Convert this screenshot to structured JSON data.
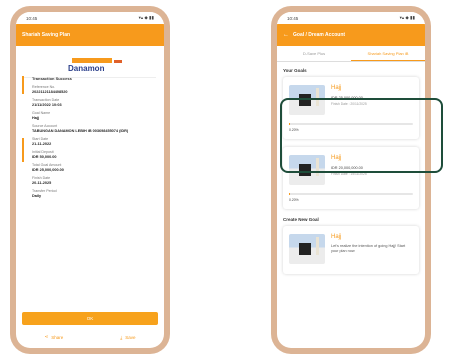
{
  "left": {
    "status_time": "10:45",
    "status_icons": "▾▴ ◆ ▮▮",
    "title": "Shariah Saving Plan",
    "bank_logo": "Danamon",
    "transaction_title": "Transaction Success",
    "fields": [
      {
        "label": "Reference No.",
        "value": "20221121184408520"
      },
      {
        "label": "Transaction Date",
        "value": "21/11/2022 10:03"
      },
      {
        "label": "Goal Name",
        "value": "Hajj"
      },
      {
        "label": "Source Account",
        "value": "TABUNGAN DANAMON LEBIH iB 003698455074 (IDR)"
      },
      {
        "label": "Start Date",
        "value": "21-11-2022"
      },
      {
        "label": "Initial Deposit",
        "value": "IDR 50,000.00"
      },
      {
        "label": "Total Goal Amount",
        "value": "IDR 25,000,000.00"
      },
      {
        "label": "Finish Date",
        "value": "20-11-2025"
      },
      {
        "label": "Transfer Period",
        "value": "Daily"
      }
    ],
    "ok_label": "OK",
    "share_label": "Share",
    "save_label": "Save"
  },
  "right": {
    "status_time": "10:45",
    "status_icons": "▾▴ ◆ ▮▮",
    "title": "Goal / Dream Account",
    "tabs": [
      {
        "label": "D-Save Plus"
      },
      {
        "label": "Shariah Saving Plan iB"
      }
    ],
    "your_goals_title": "Your Goals",
    "goals": [
      {
        "name": "Hajj",
        "amount": "IDR 25,000,000.00",
        "date": "Finish Date : 20/11/2025",
        "progress_text": "0.20%",
        "progress": 0.002
      },
      {
        "name": "Hajj",
        "amount": "IDR 20,000,000.00",
        "date": "Finish Date : 15/11/2025",
        "progress_text": "0.20%",
        "progress": 0.002
      }
    ],
    "create_title": "Create New Goal",
    "create": {
      "name": "Hajj",
      "desc": "Let's realize the intention of going Hajj! Start your plan now"
    }
  },
  "colors": {
    "accent": "#f79a1c",
    "highlight": "#1e4d3a",
    "frame": "#dcb495"
  }
}
